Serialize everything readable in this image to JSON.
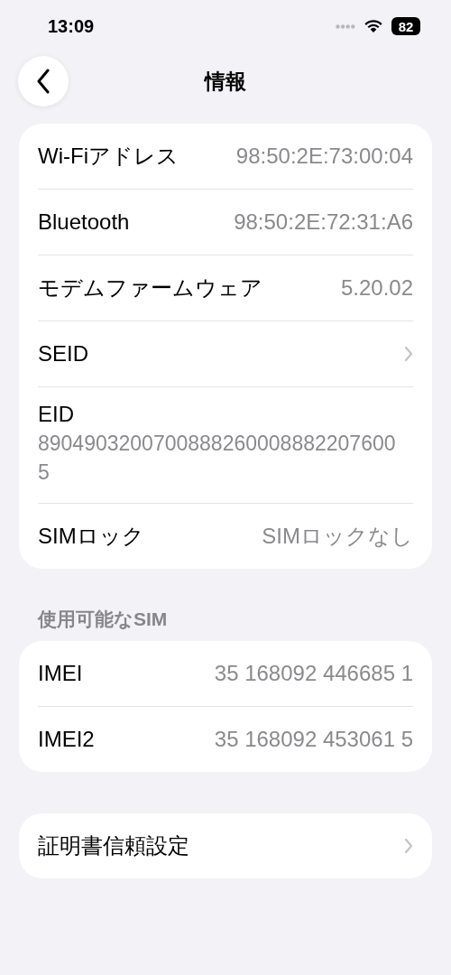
{
  "status_bar": {
    "time": "13:09",
    "battery": "82"
  },
  "nav": {
    "title": "情報"
  },
  "sections": [
    {
      "rows": [
        {
          "kind": "value",
          "label": "Wi-Fiアドレス",
          "value": "98:50:2E:73:00:04"
        },
        {
          "kind": "value",
          "label": "Bluetooth",
          "value": "98:50:2E:72:31:A6"
        },
        {
          "kind": "value",
          "label": "モデムファームウェア",
          "value": "5.20.02"
        },
        {
          "kind": "link",
          "label": "SEID"
        },
        {
          "kind": "stacked",
          "label": "EID",
          "value": "89049032007008882600088822076005"
        },
        {
          "kind": "value",
          "label": "SIMロック",
          "value": "SIMロックなし"
        }
      ]
    },
    {
      "header": "使用可能なSIM",
      "rows": [
        {
          "kind": "value",
          "label": "IMEI",
          "value": "35 168092 446685 1"
        },
        {
          "kind": "value",
          "label": "IMEI2",
          "value": "35 168092 453061 5"
        }
      ]
    },
    {
      "rows": [
        {
          "kind": "link",
          "label": "証明書信頼設定"
        }
      ]
    }
  ]
}
